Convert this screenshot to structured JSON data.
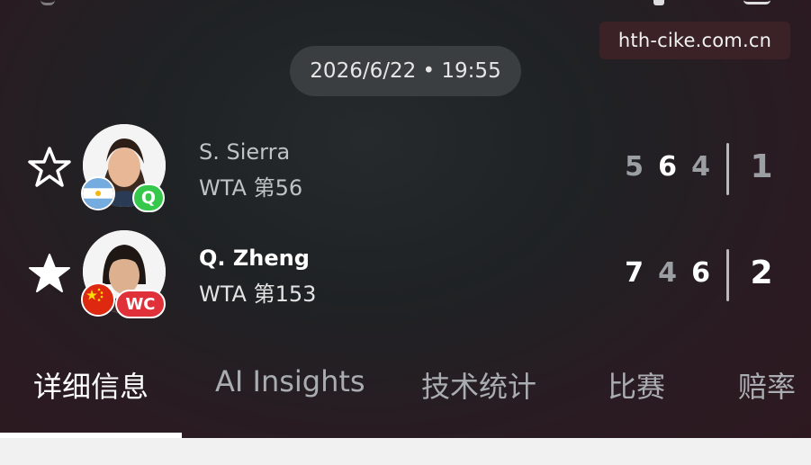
{
  "watermark": "hth-cike.com.cn",
  "match": {
    "datetime": "2026/6/22 • 19:55"
  },
  "players": [
    {
      "name": "S. Sierra",
      "rank": "WTA 第56",
      "country": "Argentina",
      "badge": "Q",
      "favorite": false,
      "sets": [
        "5",
        "6",
        "4"
      ],
      "sets_won": "1"
    },
    {
      "name": "Q. Zheng",
      "rank": "WTA 第153",
      "country": "China",
      "badge": "WC",
      "favorite": true,
      "sets": [
        "7",
        "4",
        "6"
      ],
      "sets_won": "2"
    }
  ],
  "tabs": [
    {
      "label": "详细信息",
      "active": true
    },
    {
      "label": "AI Insights",
      "active": false
    },
    {
      "label": "技术统计",
      "active": false
    },
    {
      "label": "比赛",
      "active": false
    },
    {
      "label": "赔率",
      "active": false
    }
  ],
  "colors": {
    "q_badge": "#35c84a",
    "wc_badge": "#e0303a",
    "active_text": "#ffffff",
    "inactive_text": "#a9adb1"
  }
}
